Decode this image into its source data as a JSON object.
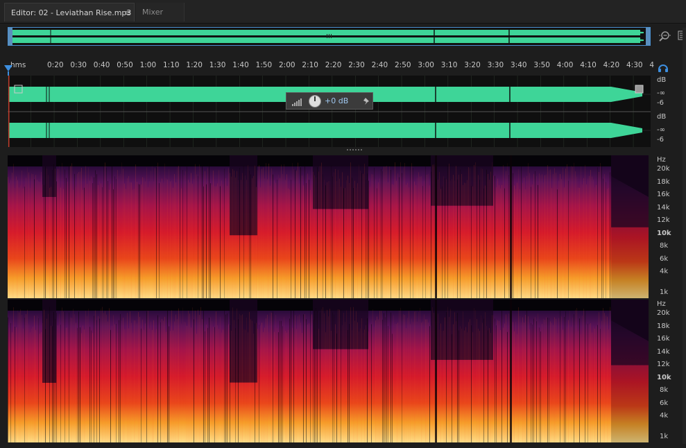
{
  "tabs": {
    "editor_label": "Editor: 02 - Leviathan Rise.mp3",
    "editor_menu": "≡",
    "mixer_label": "Mixer"
  },
  "ruler": {
    "unit": "hms",
    "ticks": [
      "0:20",
      "0:30",
      "0:40",
      "0:50",
      "1:00",
      "1:10",
      "1:20",
      "1:30",
      "1:40",
      "1:50",
      "2:00",
      "2:10",
      "2:20",
      "2:30",
      "2:40",
      "2:50",
      "3:00",
      "3:10",
      "3:20",
      "3:30",
      "3:40",
      "3:50",
      "4:00",
      "4:10",
      "4:20",
      "4:30",
      "4"
    ]
  },
  "hud": {
    "volume": "+0 dB"
  },
  "waveform_axis": {
    "channel1": [
      "dB",
      "-∞",
      "-6"
    ],
    "channel2": [
      "dB",
      "-∞",
      "-6"
    ]
  },
  "spectral_axis": {
    "unit": "Hz",
    "labels": [
      "20k",
      "18k",
      "16k",
      "14k",
      "12k",
      "10k",
      "8k",
      "6k",
      "4k",
      "1k"
    ]
  },
  "colors": {
    "waveform": "#3ed598",
    "accent": "#3d8fe0",
    "background": "#1d1d1d"
  }
}
